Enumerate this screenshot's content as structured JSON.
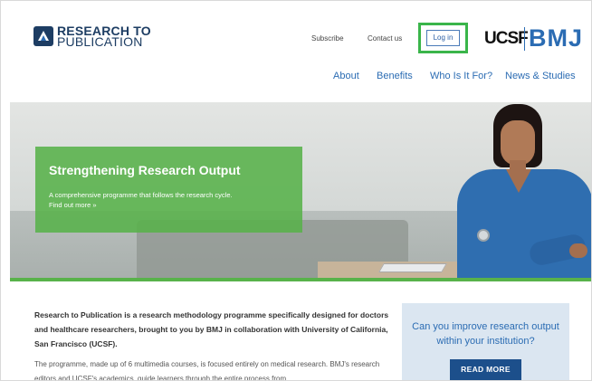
{
  "header": {
    "logo_line1": "RESEARCH TO",
    "logo_line2": "PUBLICATION",
    "subscribe": "Subscribe",
    "contact": "Contact us",
    "login": "Log in",
    "partner_ucsf": "UCSF",
    "partner_bmj": "BMJ"
  },
  "nav": {
    "items": [
      "About",
      "Benefits",
      "Who Is It For?",
      "News & Studies"
    ]
  },
  "hero": {
    "title": "Strengthening Research Output",
    "text": "A comprehensive programme that follows the research cycle.",
    "link": "Find out more »"
  },
  "content": {
    "intro": "Research to Publication is a research methodology programme specifically designed for doctors and healthcare researchers, brought to you by BMJ in collaboration with University of California, San Francisco (UCSF).",
    "body": "The programme, made up of 6 multimedia courses, is focused entirely on medical research. BMJ's research editors and UCSF's academics, guide learners through the entire process from"
  },
  "promo": {
    "text": "Can you improve research output within your institution?",
    "button": "READ MORE"
  },
  "colors": {
    "brand_blue": "#2b6cb3",
    "dark_blue": "#1d3d63",
    "green": "#58b24a",
    "highlight_green": "#3ab54a",
    "button_blue": "#1c4f8b"
  }
}
